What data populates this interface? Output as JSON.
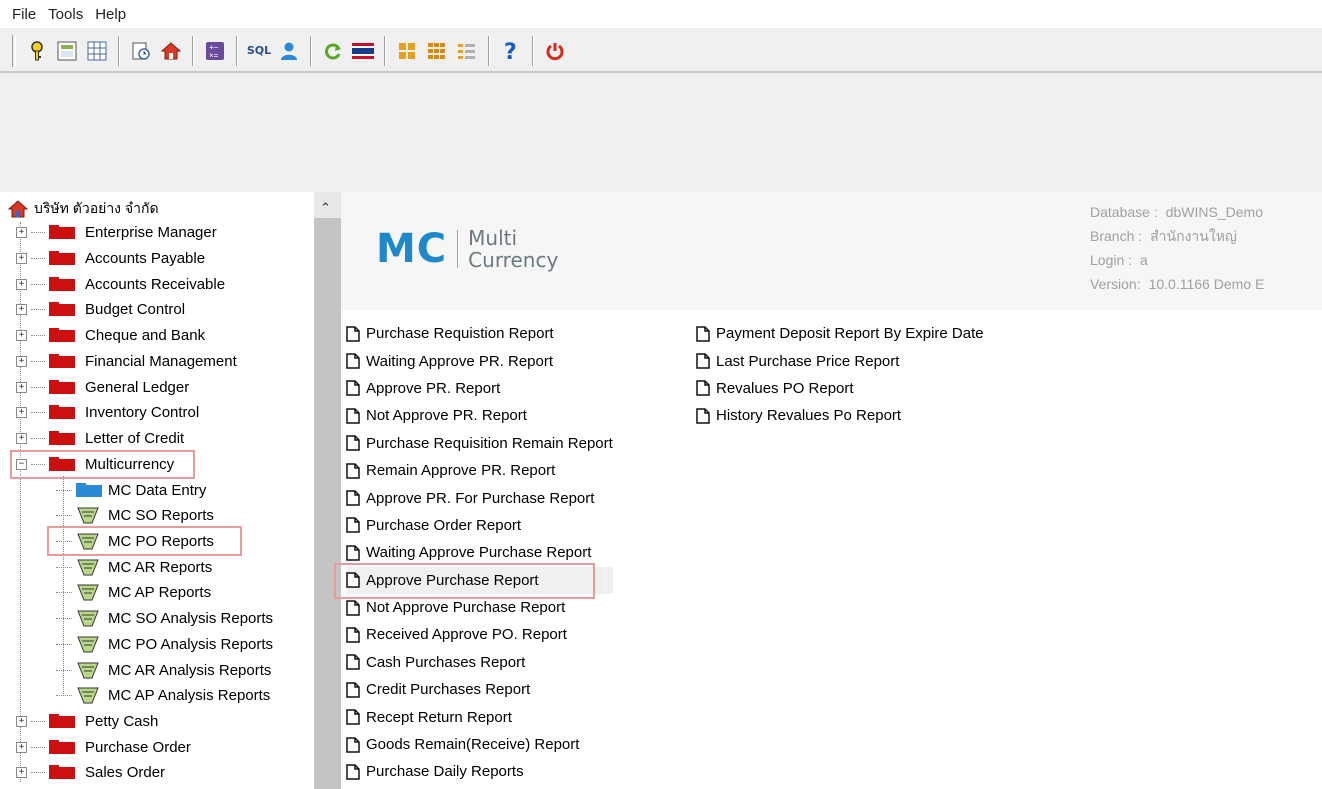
{
  "menubar": {
    "items": [
      "File",
      "Tools",
      "Help"
    ]
  },
  "toolbar": {
    "buttons": [
      "key-icon",
      "calculator-icon",
      "grid-icon",
      "clock-report-icon",
      "home-icon",
      "math-icon",
      "sql-icon",
      "user-icon",
      "refresh-icon",
      "flag-icon",
      "tiles-icon",
      "tiles2-icon",
      "list-icon",
      "help-icon",
      "power-icon"
    ],
    "sql_label": "SQL"
  },
  "tree": {
    "root_label": "บริษัท ตัวอย่าง จำกัด",
    "modules": [
      {
        "label": "Enterprise Manager",
        "expander": "+"
      },
      {
        "label": "Accounts Payable",
        "expander": "+"
      },
      {
        "label": "Accounts Receivable",
        "expander": "+"
      },
      {
        "label": "Budget Control",
        "expander": "+"
      },
      {
        "label": "Cheque and Bank",
        "expander": "+"
      },
      {
        "label": "Financial Management",
        "expander": "+"
      },
      {
        "label": "General Ledger",
        "expander": "+"
      },
      {
        "label": "Inventory Control",
        "expander": "+"
      },
      {
        "label": "Letter of Credit",
        "expander": "+"
      },
      {
        "label": "Multicurrency",
        "expander": "−"
      }
    ],
    "children": [
      "MC Data Entry",
      "MC SO Reports",
      "MC PO Reports",
      "MC AR Reports",
      "MC AP Reports",
      "MC SO Analysis Reports",
      "MC PO Analysis Reports",
      "MC AR Analysis Reports",
      "MC AP Analysis Reports"
    ],
    "modules_after": [
      {
        "label": "Petty Cash",
        "expander": "+"
      },
      {
        "label": "Purchase Order",
        "expander": "+"
      },
      {
        "label": "Sales Order",
        "expander": "+"
      }
    ]
  },
  "banner": {
    "logo_mc": "MC",
    "logo_line1": "Multi",
    "logo_line2": "Currency"
  },
  "info": {
    "database_label": "Database :",
    "database_value": "dbWINS_Demo",
    "branch_label": "Branch :",
    "branch_value": "สำนักงานใหญ่",
    "login_label": "Login :",
    "login_value": "a",
    "version_label": "Version:",
    "version_value": "10.0.1166 Demo E"
  },
  "reports_col1": [
    "Purchase Requistion Report",
    "Waiting Approve PR. Report",
    "Approve PR. Report",
    "Not Approve PR. Report",
    "Purchase Requisition Remain Report",
    "Remain Approve PR. Report",
    "Approve PR. For Purchase Report",
    "Purchase Order Report",
    "Waiting Approve Purchase Report",
    "Approve Purchase Report",
    "Not Approve Purchase Report",
    "Received Approve PO. Report",
    "Cash  Purchases Report",
    "Credit Purchases Report",
    "Recept Return Report",
    "Goods Remain(Receive) Report",
    "Purchase Daily Reports"
  ],
  "reports_col2": [
    "Payment Deposit Report By Expire Date",
    "Last Purchase Price Report",
    "Revalues PO Report",
    "History Revalues Po Report"
  ],
  "colors": {
    "accent": "#1e88c8",
    "folder_red": "#cc1010",
    "highlight": "#e99a9a"
  }
}
